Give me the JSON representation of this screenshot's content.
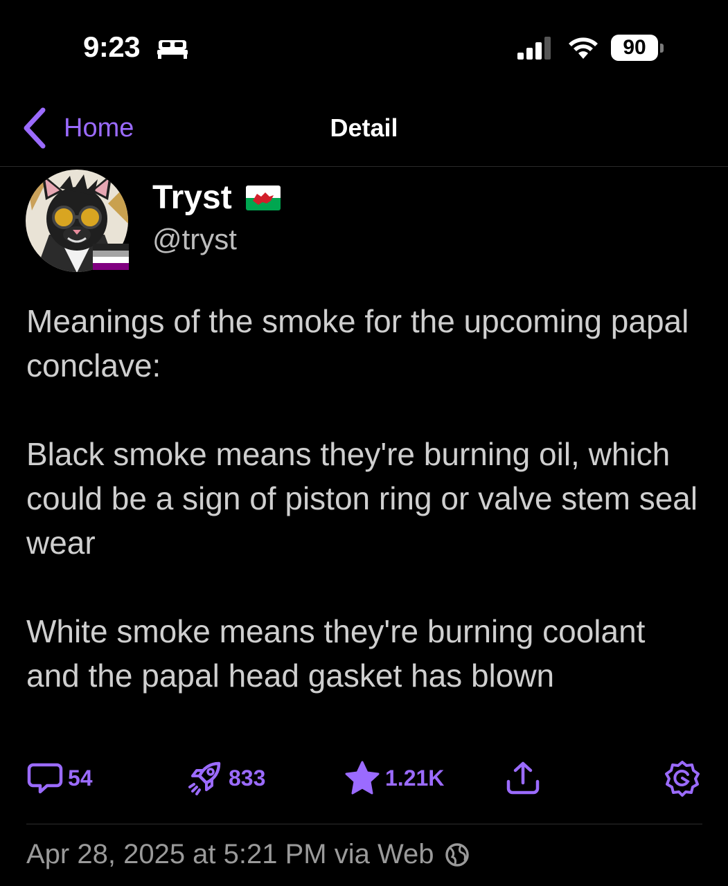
{
  "status_bar": {
    "time": "9:23",
    "battery": "90"
  },
  "nav": {
    "back_label": "Home",
    "title": "Detail"
  },
  "author": {
    "display_name": "Tryst",
    "handle": "@tryst"
  },
  "post": {
    "paragraphs": [
      "Meanings of the smoke for the upcoming papal conclave:",
      "Black smoke means they're burning oil, which could be a sign of piston ring or valve stem seal wear",
      "White smoke means they're burning coolant and the papal head gasket has blown"
    ]
  },
  "actions": {
    "replies": "54",
    "boosts": "833",
    "favorites": "1.21K"
  },
  "meta": {
    "timestamp": "Apr 28, 2025 at 5:21 PM via Web"
  },
  "colors": {
    "accent": "#9b6bff",
    "background": "#000000",
    "body_text": "#cfcfcf",
    "meta_text": "#9a9a9a"
  },
  "icons": [
    "bed-icon",
    "signal-icon",
    "wifi-icon",
    "chevron-left-icon",
    "reply-icon",
    "rocket-boost-icon",
    "star-icon",
    "share-icon",
    "settings-icon",
    "globe-icon"
  ]
}
